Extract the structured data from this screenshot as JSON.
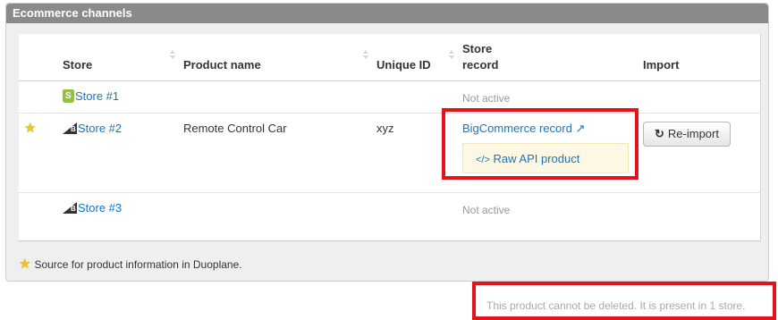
{
  "panel": {
    "title": "Ecommerce channels"
  },
  "table": {
    "headers": {
      "store": "Store",
      "product_name": "Product name",
      "unique_id": "Unique ID",
      "store_record": "Store\nrecord",
      "import": "Import"
    },
    "rows": [
      {
        "platform": "shopify",
        "store": "Store #1",
        "product_name": "",
        "unique_id": "",
        "status": "Not active"
      },
      {
        "platform": "bigcommerce",
        "is_source": true,
        "store": "Store #2",
        "product_name": "Remote Control Car",
        "unique_id": "xyz",
        "record_link": "BigCommerce record",
        "raw_link": "Raw API product",
        "import_button": "Re-import"
      },
      {
        "platform": "bigcommerce",
        "store": "Store #3",
        "product_name": "",
        "unique_id": "",
        "status": "Not active"
      }
    ]
  },
  "legend": "Source for product information in Duoplane.",
  "footer_note": "This product cannot be deleted. It is present in 1 store.",
  "colors": {
    "header": "#8a8a8a",
    "link": "#1a75bb",
    "highlight": "#e1141d",
    "raw_box": "#fcf8e3"
  }
}
